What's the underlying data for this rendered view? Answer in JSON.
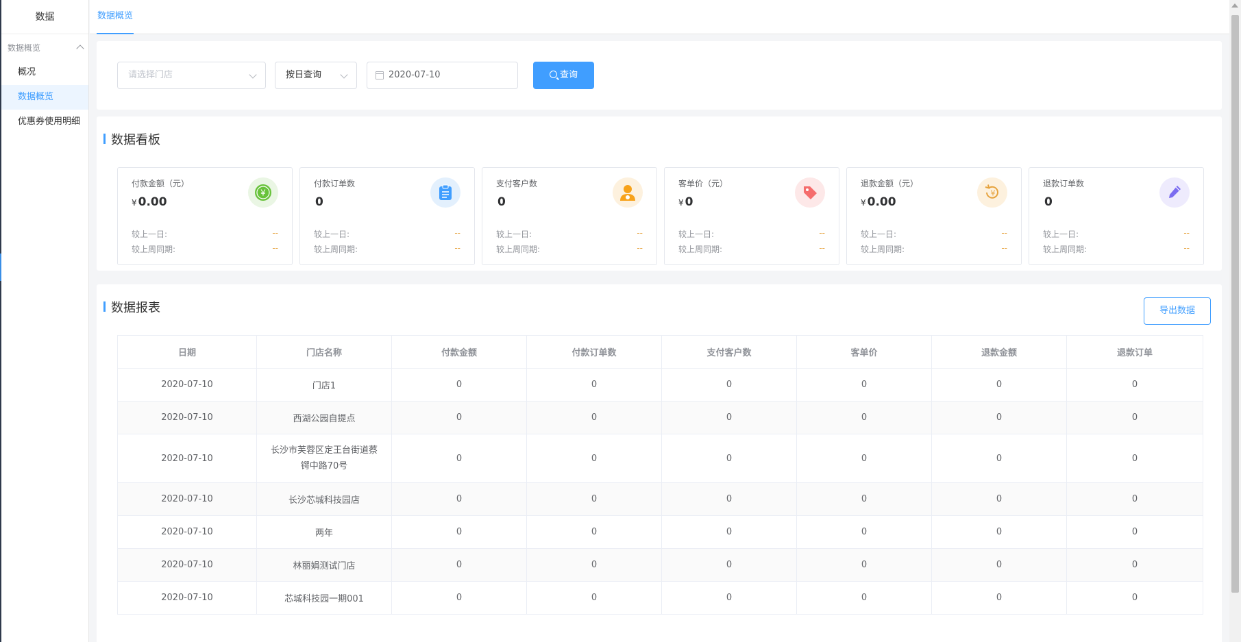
{
  "sidebar": {
    "title": "数据",
    "group_label": "数据概览",
    "items": [
      {
        "label": "概况"
      },
      {
        "label": "数据概览"
      },
      {
        "label": "优惠券使用明细"
      }
    ]
  },
  "tabs": [
    {
      "label": "数据概览"
    }
  ],
  "filter": {
    "store_placeholder": "请选择门店",
    "mode_value": "按日查询",
    "date_value": "2020-07-10",
    "query_label": "查询"
  },
  "board": {
    "title": "数据看板",
    "compare_day_label": "较上一日:",
    "compare_week_label": "较上周同期:",
    "cards": [
      {
        "label": "付款金额（元）",
        "currency": "¥",
        "value": "0.00",
        "day_change": "--",
        "week_change": "--",
        "icon": "yuan-coin-icon",
        "color": "#67c23a"
      },
      {
        "label": "付款订单数",
        "currency": "",
        "value": "0",
        "day_change": "--",
        "week_change": "--",
        "icon": "clipboard-icon",
        "color": "#409eff"
      },
      {
        "label": "支付客户数",
        "currency": "",
        "value": "0",
        "day_change": "--",
        "week_change": "--",
        "icon": "customer-icon",
        "color": "#f7a21b"
      },
      {
        "label": "客单价（元）",
        "currency": "¥",
        "value": "0",
        "day_change": "--",
        "week_change": "--",
        "icon": "price-tag-icon",
        "color": "#f56c6c"
      },
      {
        "label": "退款金额（元）",
        "currency": "¥",
        "value": "0.00",
        "day_change": "--",
        "week_change": "--",
        "icon": "refund-icon",
        "color": "#e6a23c"
      },
      {
        "label": "退款订单数",
        "currency": "",
        "value": "0",
        "day_change": "--",
        "week_change": "--",
        "icon": "pencil-icon",
        "color": "#7b6cf0"
      }
    ]
  },
  "report": {
    "title": "数据报表",
    "export_label": "导出数据",
    "columns": [
      "日期",
      "门店名称",
      "付款金额",
      "付款订单数",
      "支付客户数",
      "客单价",
      "退款金额",
      "退款订单"
    ],
    "rows": [
      [
        "2020-07-10",
        "门店1",
        "0",
        "0",
        "0",
        "0",
        "0",
        "0"
      ],
      [
        "2020-07-10",
        "西湖公园自提点",
        "0",
        "0",
        "0",
        "0",
        "0",
        "0"
      ],
      [
        "2020-07-10",
        "长沙市芙蓉区定王台街道蔡锷中路70号",
        "0",
        "0",
        "0",
        "0",
        "0",
        "0"
      ],
      [
        "2020-07-10",
        "长沙芯城科技园店",
        "0",
        "0",
        "0",
        "0",
        "0",
        "0"
      ],
      [
        "2020-07-10",
        "两年",
        "0",
        "0",
        "0",
        "0",
        "0",
        "0"
      ],
      [
        "2020-07-10",
        "林丽娟测试门店",
        "0",
        "0",
        "0",
        "0",
        "0",
        "0"
      ],
      [
        "2020-07-10",
        "芯城科技园一期001",
        "0",
        "0",
        "0",
        "0",
        "0",
        "0"
      ]
    ]
  },
  "colors": {
    "accent": "#409eff"
  }
}
